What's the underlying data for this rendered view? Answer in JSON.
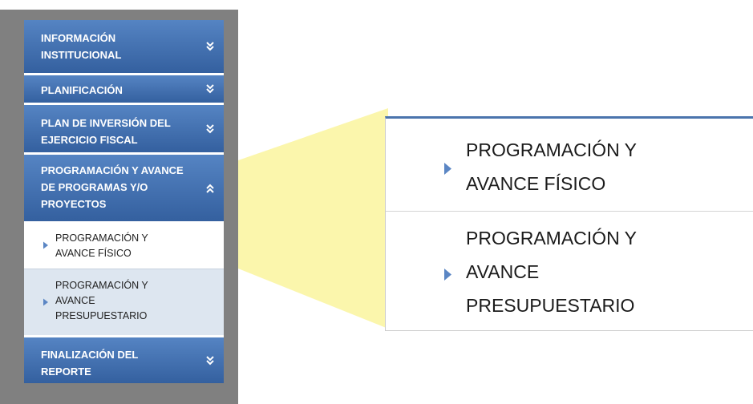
{
  "colors": {
    "menu_blue": "#3a66a6",
    "highlight_yellow": "#fbf6a8",
    "sidebar_frame": "#808080",
    "submenu_alt_bg": "#dde6f0",
    "arrow_blue": "#5b86c4"
  },
  "sidebar": {
    "sections": [
      {
        "label": "INFORMACIÓN\nINSTITUCIONAL",
        "state": "collapsed",
        "icon": "chevron-double-down-icon"
      },
      {
        "label": "PLANIFICACIÓN",
        "state": "collapsed",
        "icon": "chevron-double-down-icon"
      },
      {
        "label": "PLAN DE INVERSIÓN DEL\nEJERCICIO FISCAL",
        "state": "collapsed",
        "icon": "chevron-double-down-icon"
      },
      {
        "label": "PROGRAMACIÓN Y AVANCE\nDE PROGRAMAS Y/O\nPROYECTOS",
        "state": "expanded",
        "icon": "chevron-double-up-icon",
        "items": [
          {
            "label": "PROGRAMACIÓN Y\nAVANCE FÍSICO",
            "icon": "triangle-right-icon"
          },
          {
            "label": "PROGRAMACIÓN Y\nAVANCE\nPRESUPUESTARIO",
            "icon": "triangle-right-icon"
          }
        ]
      },
      {
        "label": "FINALIZACIÓN DEL\nREPORTE",
        "state": "collapsed",
        "icon": "chevron-double-down-icon"
      }
    ]
  },
  "zoom": {
    "items": [
      {
        "label": "PROGRAMACIÓN Y\nAVANCE FÍSICO"
      },
      {
        "label": "PROGRAMACIÓN Y\nAVANCE\nPRESUPUESTARIO"
      }
    ]
  }
}
